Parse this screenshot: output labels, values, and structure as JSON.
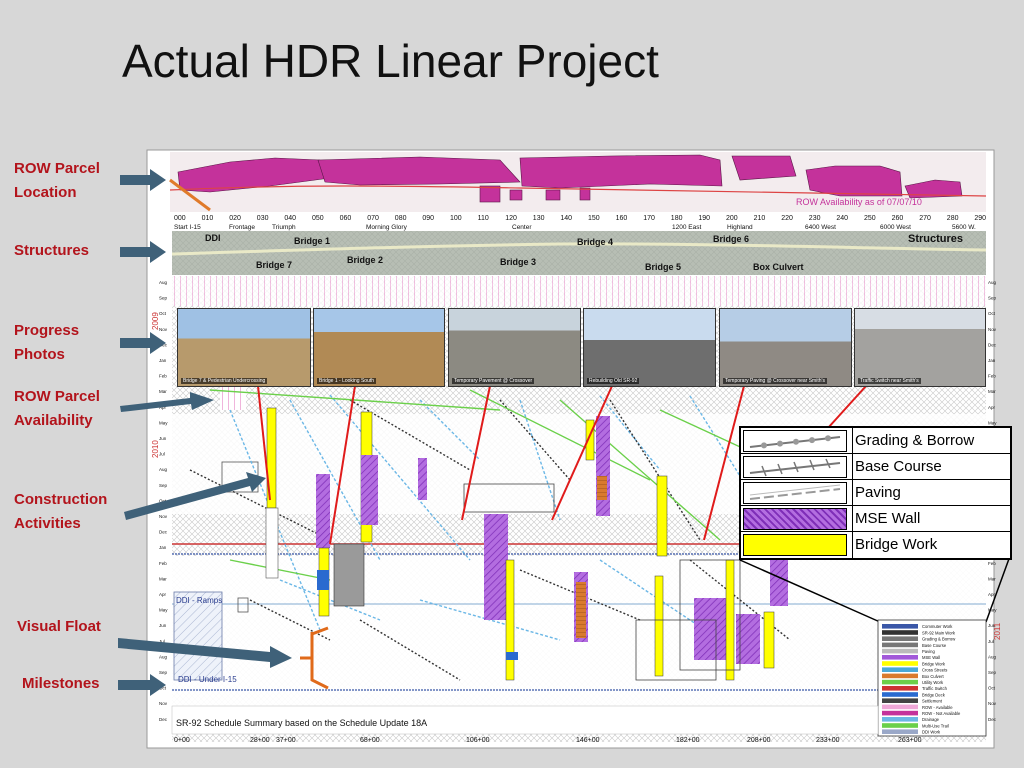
{
  "slide": {
    "title": "Actual HDR Linear Project"
  },
  "side_labels": [
    {
      "id": "row-parcel-location",
      "text": "ROW Parcel\nLocation"
    },
    {
      "id": "structures",
      "text": "Structures"
    },
    {
      "id": "progress-photos",
      "text": "Progress\nPhotos"
    },
    {
      "id": "row-parcel-availability",
      "text": "ROW Parcel\nAvailability"
    },
    {
      "id": "construction-activities",
      "text": "Construction\nActivities"
    },
    {
      "id": "visual-float",
      "text": "Visual Float"
    },
    {
      "id": "milestones",
      "text": "Milestones"
    }
  ],
  "diagram": {
    "row_banner": "ROW Availability as of 07/07/10",
    "stations": [
      "000",
      "010",
      "020",
      "030",
      "040",
      "050",
      "060",
      "070",
      "080",
      "090",
      "100",
      "110",
      "120",
      "130",
      "140",
      "150",
      "160",
      "170",
      "180",
      "190",
      "200",
      "210",
      "220",
      "230",
      "240",
      "250",
      "260",
      "270",
      "280",
      "290"
    ],
    "station_names": [
      "Start I-15",
      "Frontage",
      "Triumph",
      "Morning Glory",
      "Center",
      "1200 East",
      "Highland",
      "6400 West",
      "6000 West",
      "5600 W."
    ],
    "structure_labels": [
      "DDI",
      "Bridge 1",
      "Bridge 2",
      "Bridge 7",
      "Bridge 3",
      "Bridge 4",
      "Bridge 5",
      "Bridge 6",
      "Box Culvert",
      "Structures"
    ],
    "years": [
      "2009",
      "2010",
      "2011"
    ],
    "months_left": [
      "Aug",
      "Sep",
      "Oct",
      "Nov",
      "Dec",
      "Jan",
      "Feb",
      "Mar",
      "Apr",
      "May",
      "Jun",
      "Jul",
      "Aug",
      "Sep",
      "Oct",
      "Nov",
      "Dec",
      "Jan",
      "Feb",
      "Mar",
      "Apr",
      "May",
      "Jun",
      "Jul",
      "Aug",
      "Sep",
      "Oct",
      "Nov",
      "Dec"
    ],
    "photo_captions": [
      "Bridge 7 & Pedestrian Undercrossing",
      "Bridge 1 - Looking South",
      "Temporary Pavement @ Crossover",
      "Rebuilding Old SR-92",
      "Temporary Paving @ Crossover near Smith's",
      "Traffic Switch near Smith's"
    ],
    "ddi_labels": [
      "DDI - Ramps",
      "DDI - Under I-15"
    ],
    "schedule_summary": "SR-92 Schedule Summary based on the Schedule Update 18A",
    "bottom_stations": [
      "0+00",
      "28+00",
      "37+00",
      "68+00",
      "106+00",
      "146+00",
      "182+00",
      "208+00",
      "233+00",
      "263+00"
    ]
  },
  "legend": {
    "items": [
      {
        "label": "Grading & Borrow",
        "style": "grading"
      },
      {
        "label": "Base Course",
        "style": "base"
      },
      {
        "label": "Paving",
        "style": "paving"
      },
      {
        "label": "MSE Wall",
        "style": "mse"
      },
      {
        "label": "Bridge Work",
        "style": "bridge"
      }
    ]
  },
  "mini_legend": [
    "Commuter Work",
    "SR-92 Main Work",
    "Grading & Borrow",
    "Base Course",
    "Paving",
    "MSE Wall",
    "Bridge Work",
    "Cross Streets",
    "Box Culvert",
    "Utility Work",
    "Traffic Switch",
    "Bridge Deck",
    "Settlement",
    "ROW - Available",
    "ROW - Not Available",
    "Drainage",
    "Multi-Use Trail",
    "DDI Work"
  ],
  "colors": {
    "label_red": "#b3141c",
    "arrow_blue": "#3f6179",
    "row_magenta": "#c4329b",
    "mse_purple": "#a259d9",
    "bridge_yellow": "#ffff00",
    "milestone_orange": "#e06a1a"
  }
}
